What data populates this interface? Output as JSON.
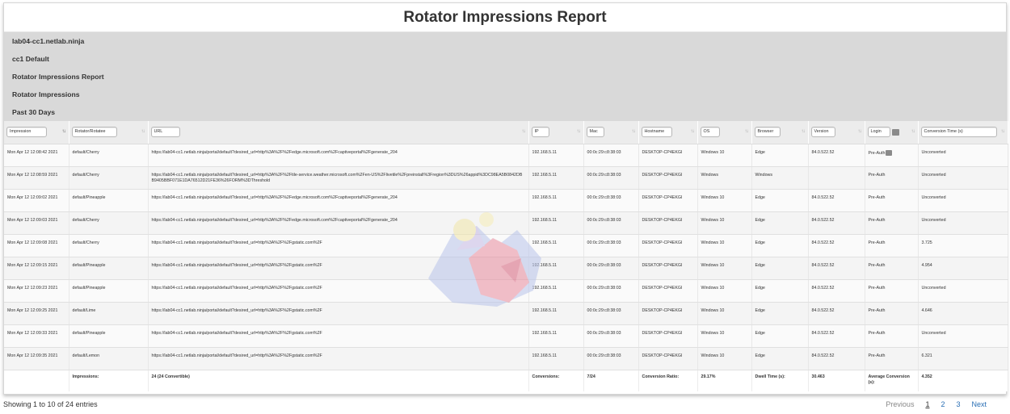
{
  "title": "Rotator Impressions Report",
  "meta_lines": [
    "lab04-cc1.netlab.ninja",
    "cc1 Default",
    "Rotator Impressions Report",
    "Rotator Impressions",
    "Past 30 Days"
  ],
  "columns": [
    {
      "label": "Impression",
      "sort_icon": "sort-asc-icon"
    },
    {
      "label": "Rotator/Rotatee",
      "sort_icon": "sort-icon"
    },
    {
      "label": "URL",
      "sort_icon": "sort-icon"
    },
    {
      "label": "IP",
      "sort_icon": "sort-icon"
    },
    {
      "label": "Mac",
      "sort_icon": "sort-icon"
    },
    {
      "label": "Hostname",
      "sort_icon": "sort-icon"
    },
    {
      "label": "OS",
      "sort_icon": "sort-icon"
    },
    {
      "label": "Browser",
      "sort_icon": "sort-icon"
    },
    {
      "label": "Version",
      "sort_icon": "sort-icon"
    },
    {
      "label": "Login",
      "sort_icon": "sort-icon"
    },
    {
      "label": "Conversion Time (s)",
      "sort_icon": "sort-icon"
    }
  ],
  "rows": [
    {
      "impression": "Mon Apr 12 12:08:42 2021",
      "rotator": "default/Cherry",
      "url": "https://lab04-cc1.netlab.ninja/portal/default?desired_url=http%3A%2F%2Fedge.microsoft.com%2Fcaptiveportal%2Fgenerate_204",
      "ip": "192.168.5.11",
      "mac": "00:0c:29:c8:38:03",
      "hostname": "DESKTOP-CP4EKGI",
      "os": "Windows 10",
      "browser": "Edge",
      "version": "84.0.522.52",
      "login": "Pre-Auth",
      "conversion": "Unconverted"
    },
    {
      "impression": "Mon Apr 12 12:08:59 2021",
      "rotator": "default/Cherry",
      "url": "https://lab04-cc1.netlab.ninja/portal/default?desired_url=http%3A%2F%2Ftile-service.weather.microsoft.com%2Fen-US%2Flivetile%2Fpreinstall%3Fregion%3DUS%26appid%3DC98EA5B0842DBB9405BBF071E1DA76512D21FE36%26FORM%3DThreshold",
      "ip": "192.168.5.11",
      "mac": "00:0c:29:c8:38:03",
      "hostname": "DESKTOP-CP4EKGI",
      "os": "Windows",
      "browser": "Windows",
      "version": "",
      "login": "Pre-Auth",
      "conversion": "Unconverted"
    },
    {
      "impression": "Mon Apr 12 12:09:02 2021",
      "rotator": "default/Pineapple",
      "url": "https://lab04-cc1.netlab.ninja/portal/default?desired_url=http%3A%2F%2Fedge.microsoft.com%2Fcaptiveportal%2Fgenerate_204",
      "ip": "192.168.5.11",
      "mac": "00:0c:29:c8:38:03",
      "hostname": "DESKTOP-CP4EKGI",
      "os": "Windows 10",
      "browser": "Edge",
      "version": "84.0.522.52",
      "login": "Pre-Auth",
      "conversion": "Unconverted"
    },
    {
      "impression": "Mon Apr 12 12:09:03 2021",
      "rotator": "default/Cherry",
      "url": "https://lab04-cc1.netlab.ninja/portal/default?desired_url=http%3A%2F%2Fedge.microsoft.com%2Fcaptiveportal%2Fgenerate_204",
      "ip": "192.168.5.11",
      "mac": "00:0c:29:c8:38:03",
      "hostname": "DESKTOP-CP4EKGI",
      "os": "Windows 10",
      "browser": "Edge",
      "version": "84.0.522.52",
      "login": "Pre-Auth",
      "conversion": "Unconverted"
    },
    {
      "impression": "Mon Apr 12 12:09:08 2021",
      "rotator": "default/Cherry",
      "url": "https://lab04-cc1.netlab.ninja/portal/default?desired_url=http%3A%2F%2Fgstatic.com%2F",
      "ip": "192.168.5.11",
      "mac": "00:0c:29:c8:38:03",
      "hostname": "DESKTOP-CP4EKGI",
      "os": "Windows 10",
      "browser": "Edge",
      "version": "84.0.522.52",
      "login": "Pre-Auth",
      "conversion": "3.725"
    },
    {
      "impression": "Mon Apr 12 12:09:15 2021",
      "rotator": "default/Pineapple",
      "url": "https://lab04-cc1.netlab.ninja/portal/default?desired_url=http%3A%2F%2Fgstatic.com%2F",
      "ip": "192.168.5.11",
      "mac": "00:0c:29:c8:38:03",
      "hostname": "DESKTOP-CP4EKGI",
      "os": "Windows 10",
      "browser": "Edge",
      "version": "84.0.522.52",
      "login": "Pre-Auth",
      "conversion": "4.954"
    },
    {
      "impression": "Mon Apr 12 12:09:23 2021",
      "rotator": "default/Pineapple",
      "url": "https://lab04-cc1.netlab.ninja/portal/default?desired_url=http%3A%2F%2Fgstatic.com%2F",
      "ip": "192.168.5.11",
      "mac": "00:0c:29:c8:38:03",
      "hostname": "DESKTOP-CP4EKGI",
      "os": "Windows 10",
      "browser": "Edge",
      "version": "84.0.522.52",
      "login": "Pre-Auth",
      "conversion": "Unconverted"
    },
    {
      "impression": "Mon Apr 12 12:09:25 2021",
      "rotator": "default/Lime",
      "url": "https://lab04-cc1.netlab.ninja/portal/default?desired_url=http%3A%2F%2Fgstatic.com%2F",
      "ip": "192.168.5.11",
      "mac": "00:0c:29:c8:38:03",
      "hostname": "DESKTOP-CP4EKGI",
      "os": "Windows 10",
      "browser": "Edge",
      "version": "84.0.522.52",
      "login": "Pre-Auth",
      "conversion": "4.646"
    },
    {
      "impression": "Mon Apr 12 12:09:33 2021",
      "rotator": "default/Pineapple",
      "url": "https://lab04-cc1.netlab.ninja/portal/default?desired_url=http%3A%2F%2Fgstatic.com%2F",
      "ip": "192.168.5.11",
      "mac": "00:0c:29:c8:38:03",
      "hostname": "DESKTOP-CP4EKGI",
      "os": "Windows 10",
      "browser": "Edge",
      "version": "84.0.522.52",
      "login": "Pre-Auth",
      "conversion": "Unconverted"
    },
    {
      "impression": "Mon Apr 12 12:09:35 2021",
      "rotator": "default/Lemon",
      "url": "https://lab04-cc1.netlab.ninja/portal/default?desired_url=http%3A%2F%2Fgstatic.com%2F",
      "ip": "192.168.5.11",
      "mac": "00:0c:29:c8:38:03",
      "hostname": "DESKTOP-CP4EKGI",
      "os": "Windows 10",
      "browser": "Edge",
      "version": "84.0.522.52",
      "login": "Pre-Auth",
      "conversion": "6.321"
    }
  ],
  "summary": {
    "impressions_label": "Impressions:",
    "impressions_value": "24 (24 Convertible)",
    "conversions_label": "Conversions:",
    "conversions_value": "7/24",
    "ratio_label": "Conversion Ratio:",
    "ratio_value": "29.17%",
    "dwell_label": "Dwell Time (s):",
    "dwell_value": "30.463",
    "avg_label": "Average Conversion (s):",
    "avg_value": "4.352"
  },
  "footer": {
    "entries_info": "Showing 1 to 10 of 24 entries",
    "previous": "Previous",
    "pages": [
      "1",
      "2",
      "3"
    ],
    "next": "Next"
  }
}
